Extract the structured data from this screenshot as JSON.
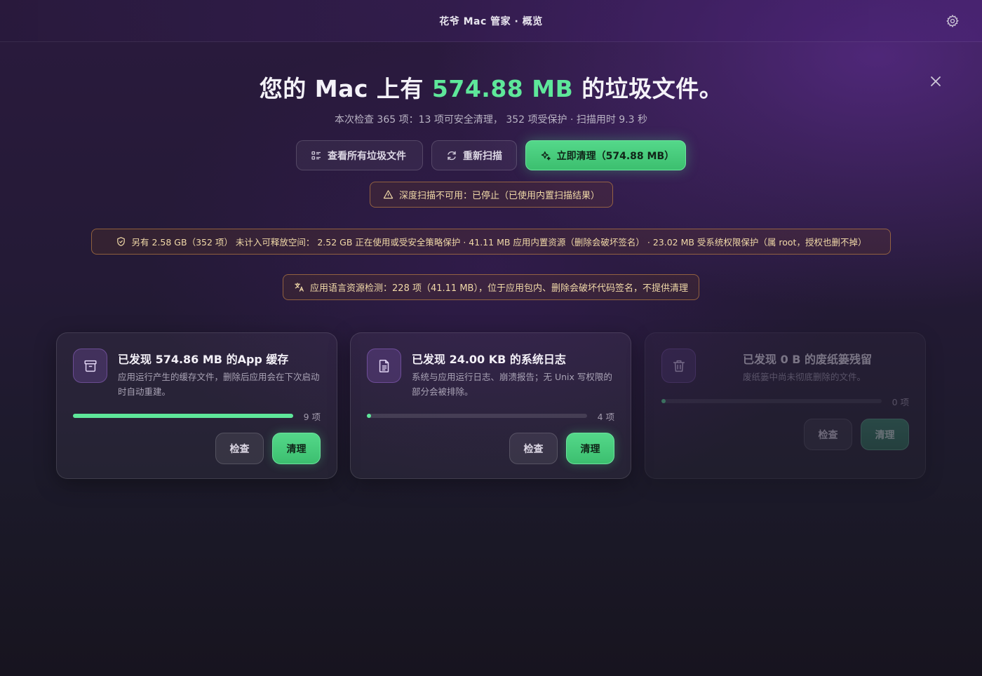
{
  "window": {
    "title": "花爷 Mac 管家 · 概览"
  },
  "hero": {
    "prefix": "您的 Mac 上有 ",
    "amount": "574.88 MB",
    "suffix": " 的垃圾文件。"
  },
  "summary": "本次检查 365 项：13 项可安全清理， 352 项受保护 · 扫描用时 9.3 秒",
  "actions": {
    "view_all": "查看所有垃圾文件",
    "rescan": "重新扫描",
    "clean_now": "立即清理（574.88 MB）"
  },
  "notices": {
    "deep_scan": "深度扫描不可用：已停止（已使用内置扫描结果）",
    "protected": "另有 2.58 GB（352 项） 未计入可释放空间： 2.52 GB 正在使用或受安全策略保护 · 41.11 MB 应用内置资源（删除会破坏签名） · 23.02 MB 受系统权限保护（属 root，授权也删不掉）",
    "language": "应用语言资源检测：228 项（41.11 MB），位于应用包内、删除会破坏代码签名，不提供清理"
  },
  "cards": [
    {
      "title": "已发现 574.86 MB 的App 缓存",
      "desc": "应用运行产生的缓存文件，删除后应用会在下次启动时自动重建。",
      "count": "9 项",
      "progress": 1.0,
      "inspect": "检查",
      "clean": "清理",
      "icon": "archive-icon"
    },
    {
      "title": "已发现 24.00 KB 的系统日志",
      "desc": "系统与应用运行日志、崩溃报告；无 Unix 写权限的部分会被排除。",
      "count": "4 项",
      "progress": 0.0,
      "inspect": "检查",
      "clean": "清理",
      "icon": "document-icon"
    },
    {
      "title": "已发现 0 B 的废纸篓残留",
      "desc": "废纸篓中尚未彻底删除的文件。",
      "count": "0 项",
      "progress": 0.0,
      "inspect": "检查",
      "clean": "清理",
      "icon": "trash-icon"
    }
  ],
  "colors": {
    "accent": "#5ee79a",
    "warning_border": "#dc9646"
  }
}
